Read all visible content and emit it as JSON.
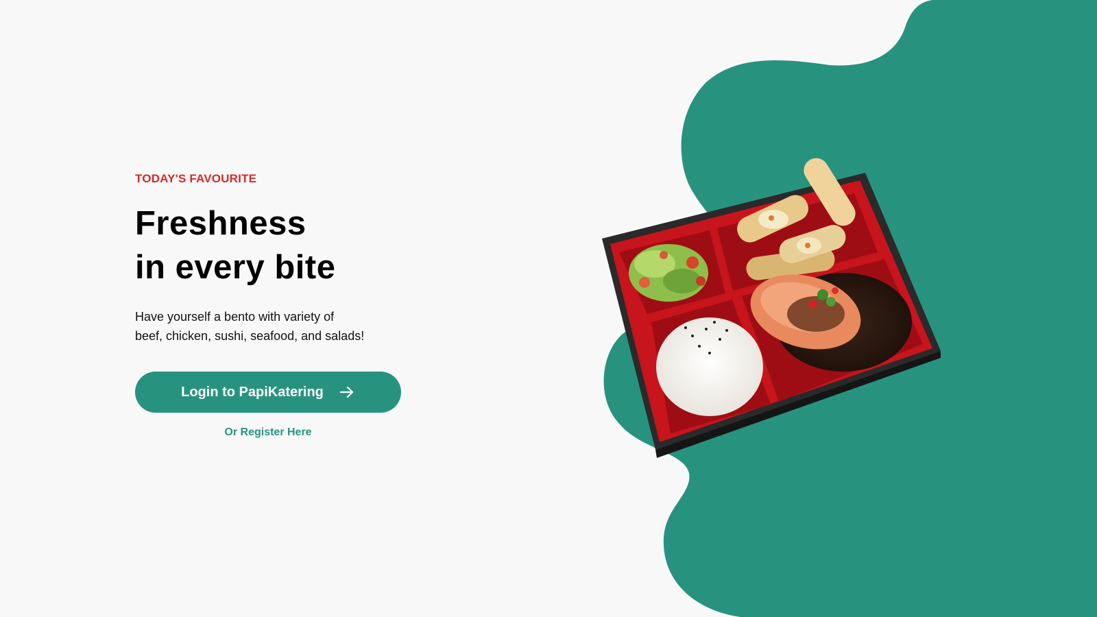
{
  "hero": {
    "eyebrow": "TODAY'S FAVOURITE",
    "headline_line1": "Freshness",
    "headline_line2": "in every bite",
    "description_line1": "Have yourself a bento with variety of",
    "description_line2": "beef, chicken, sushi, seafood, and salads!",
    "login_button_label": "Login to PapiKatering",
    "register_link_label": "Or Register Here"
  },
  "icons": {
    "login_arrow": "arrow-right-icon"
  },
  "colors": {
    "accent_green": "#27937e",
    "eyebrow_red": "#d62a2a",
    "background": "#f8f8f8"
  }
}
